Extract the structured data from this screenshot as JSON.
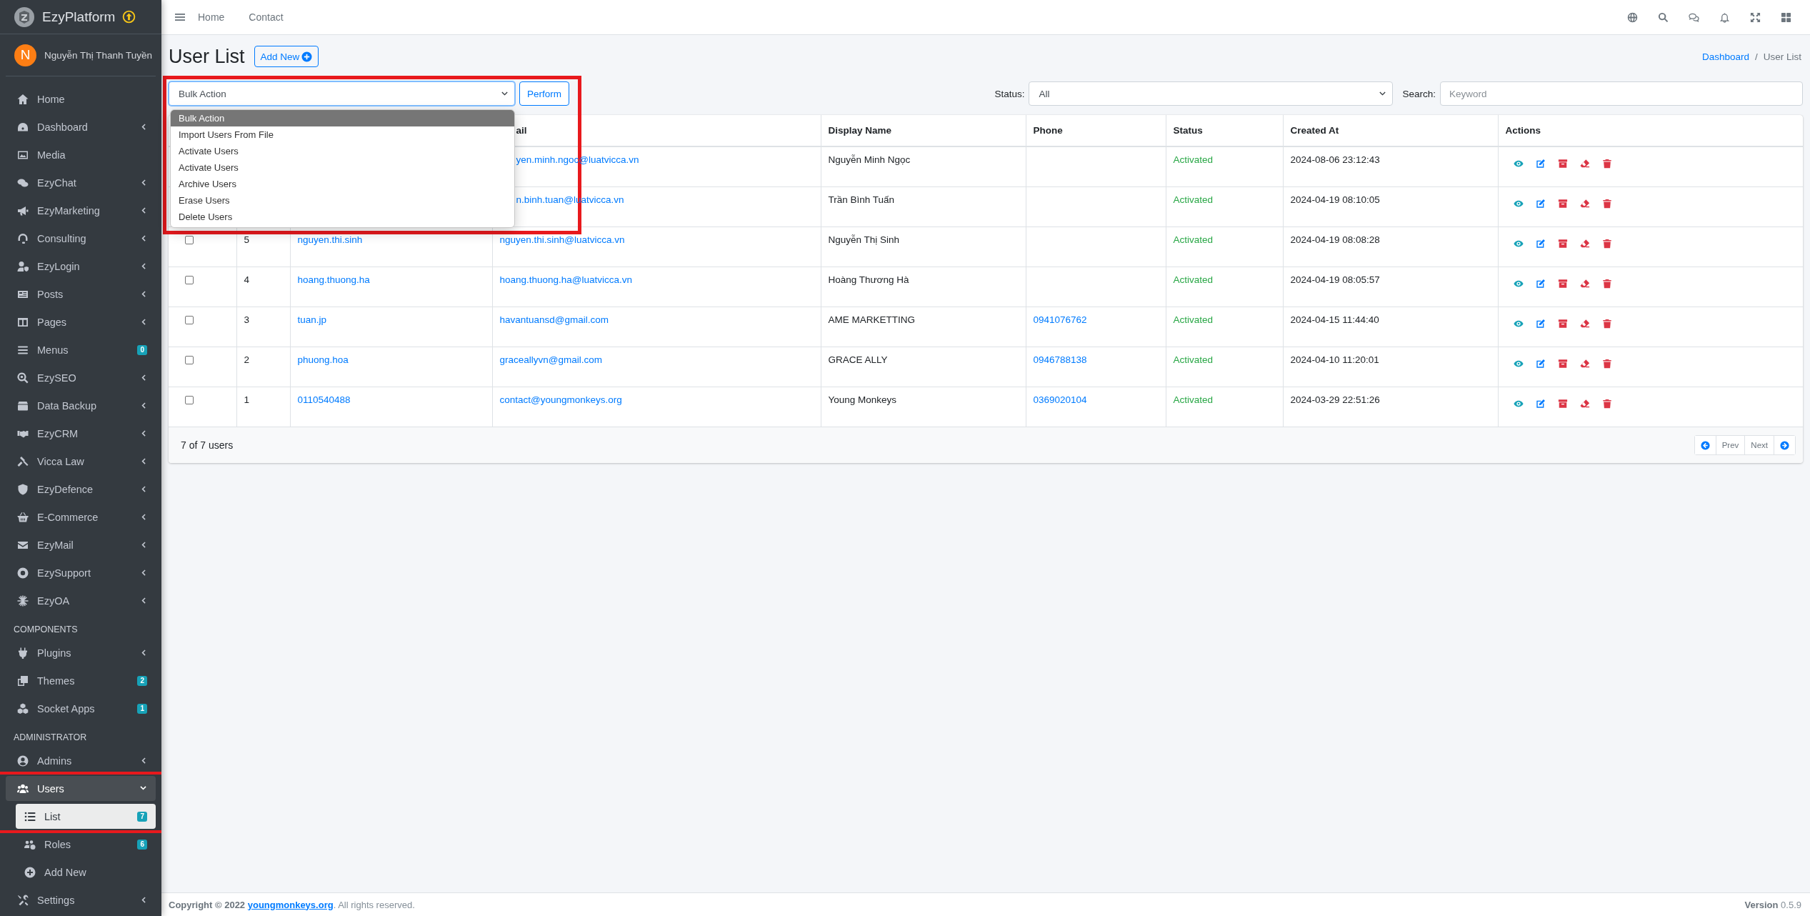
{
  "sidebar": {
    "brand": "EzyPlatform",
    "user": {
      "initial": "N",
      "name": "Nguyễn Thị Thanh Tuyền"
    },
    "sections": [
      {
        "items": [
          {
            "label": "Home",
            "selected": false
          },
          {
            "label": "Dashboard",
            "selected": false,
            "expanded": false
          },
          {
            "label": "Media",
            "selected": false
          },
          {
            "label": "EzyChat",
            "selected": false,
            "expanded": false
          },
          {
            "label": "EzyMarketing",
            "selected": false,
            "expanded": false
          },
          {
            "label": "Consulting",
            "selected": false,
            "expanded": false
          },
          {
            "label": "EzyLogin",
            "selected": false,
            "expanded": false
          },
          {
            "label": "Posts",
            "selected": false,
            "expanded": false
          },
          {
            "label": "Pages",
            "selected": false,
            "expanded": false
          },
          {
            "label": "Menus",
            "selected": false,
            "badge": "0"
          },
          {
            "label": "EzySEO",
            "selected": false,
            "expanded": false
          },
          {
            "label": "Data Backup",
            "selected": false,
            "expanded": false
          },
          {
            "label": "EzyCRM",
            "selected": false,
            "expanded": false
          },
          {
            "label": "Vicca Law",
            "selected": false,
            "expanded": false
          },
          {
            "label": "EzyDefence",
            "selected": false,
            "expanded": false
          },
          {
            "label": "E-Commerce",
            "selected": false,
            "expanded": false
          },
          {
            "label": "EzyMail",
            "selected": false,
            "expanded": false
          },
          {
            "label": "EzySupport",
            "selected": false,
            "expanded": false
          },
          {
            "label": "EzyOA",
            "selected": false,
            "expanded": false
          }
        ]
      },
      {
        "header": "COMPONENTS",
        "items": [
          {
            "label": "Plugins",
            "selected": false,
            "expanded": false
          },
          {
            "label": "Themes",
            "selected": false,
            "badge": "2"
          },
          {
            "label": "Socket Apps",
            "selected": false,
            "badge": "1"
          }
        ]
      },
      {
        "header": "ADMINISTRATOR",
        "items": [
          {
            "label": "Admins",
            "selected": false,
            "expanded": false
          },
          {
            "label": "Users",
            "selected": false,
            "expanded": true,
            "highlighted": true,
            "children": [
              {
                "label": "List",
                "selected": true,
                "badge": "7"
              },
              {
                "label": "Roles",
                "selected": false,
                "badge": "6"
              },
              {
                "label": "Add New",
                "selected": false
              }
            ]
          },
          {
            "label": "Settings",
            "selected": false,
            "expanded": false
          }
        ]
      }
    ]
  },
  "topbar": {
    "links": [
      "Home",
      "Contact"
    ]
  },
  "page": {
    "title": "User List",
    "add_button": "Add New",
    "breadcrumb": {
      "items": [
        "Dashboard",
        "User List"
      ],
      "separator": "/"
    }
  },
  "filters": {
    "bulk_action": {
      "value": "Bulk Action",
      "open": true,
      "highlighted": true,
      "options": [
        {
          "label": "Bulk Action",
          "selected": true
        },
        {
          "label": "Import Users From File",
          "selected": false
        },
        {
          "label": "Activate Users",
          "selected": false
        },
        {
          "label": "Activate Users",
          "selected": false
        },
        {
          "label": "Archive Users",
          "selected": false
        },
        {
          "label": "Erase Users",
          "selected": false
        },
        {
          "label": "Delete Users",
          "selected": false
        }
      ]
    },
    "perform_button": "Perform",
    "status_label": "Status:",
    "status_value": "All",
    "search_label": "Search:",
    "search_placeholder": "Keyword"
  },
  "table": {
    "columns": [
      "ail",
      "Display Name",
      "Phone",
      "Status",
      "Created At",
      "Actions"
    ],
    "rows": [
      {
        "email": "yen.minh.ngoc@luatvicca.vn",
        "display_name": "Nguyễn Minh Ngọc",
        "status": "Activated",
        "created_at": "2024-08-06 23:12:43"
      },
      {
        "email": "n.binh.tuan@luatvicca.vn",
        "display_name": "Trần Bình Tuấn",
        "status": "Activated",
        "created_at": "2024-04-19 08:10:05"
      },
      {
        "checked": false,
        "id": "5",
        "username": "nguyen.thi.sinh",
        "email": "nguyen.thi.sinh@luatvicca.vn",
        "display_name": "Nguyễn Thị Sinh",
        "status": "Activated",
        "created_at": "2024-04-19 08:08:28"
      },
      {
        "checked": false,
        "id": "4",
        "username": "hoang.thuong.ha",
        "email": "hoang.thuong.ha@luatvicca.vn",
        "display_name": "Hoàng Thương Hà",
        "status": "Activated",
        "created_at": "2024-04-19 08:05:57"
      },
      {
        "checked": false,
        "id": "3",
        "username": "tuan.jp",
        "email": "havantuansd@gmail.com",
        "display_name": "AME MARKETTING",
        "phone": "0941076762",
        "status": "Activated",
        "created_at": "2024-04-15 11:44:40"
      },
      {
        "checked": false,
        "id": "2",
        "username": "phuong.hoa",
        "email": "graceallyvn@gmail.com",
        "display_name": "GRACE ALLY",
        "phone": "0946788138",
        "status": "Activated",
        "created_at": "2024-04-10 11:20:01"
      },
      {
        "checked": false,
        "id": "1",
        "username": "0110540488",
        "email": "contact@youngmonkeys.org",
        "display_name": "Young Monkeys",
        "phone": "0369020104",
        "status": "Activated",
        "created_at": "2024-03-29 22:51:26"
      }
    ],
    "summary": "7 of 7 users",
    "prev": "Prev",
    "next": "Next"
  },
  "footer": {
    "copyright": "Copyright © 2022",
    "link": "youngmonkeys.org",
    "suffix": ". All rights reserved.",
    "version_label": "Version",
    "version": "0.5.9"
  }
}
